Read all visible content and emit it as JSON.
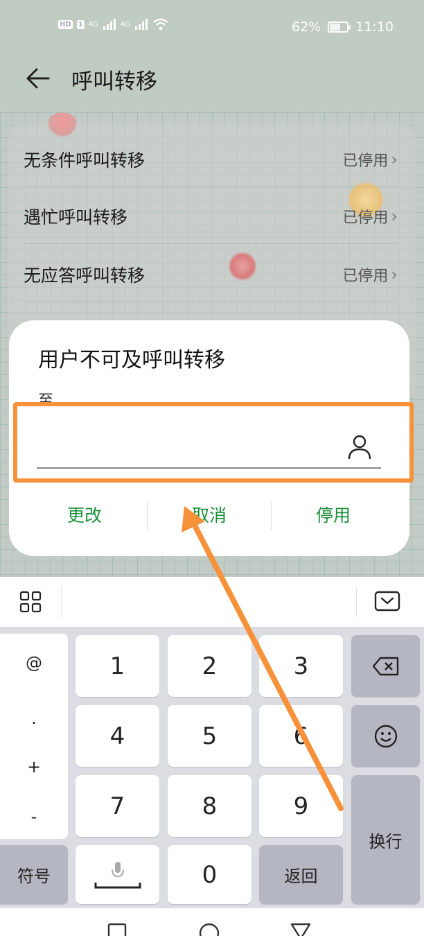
{
  "status_bar": {
    "hd_badge": "HD",
    "sim_slot": "1",
    "net_type_1": "4G",
    "net_type_2": "4G",
    "battery_percent": "62%",
    "battery_level": 0.62,
    "time": "11:10"
  },
  "header": {
    "title": "呼叫转移",
    "back_icon": "back-arrow-icon"
  },
  "settings_rows": [
    {
      "label": "无条件呼叫转移",
      "status": "已停用"
    },
    {
      "label": "遇忙呼叫转移",
      "status": "已停用"
    },
    {
      "label": "无应答呼叫转移",
      "status": "已停用"
    }
  ],
  "dialog": {
    "title": "用户不可及呼叫转移",
    "to_label": "至",
    "input_value": "",
    "contact_icon": "person-icon",
    "buttons": {
      "change": "更改",
      "cancel": "取消",
      "disable": "停用"
    },
    "accent_color": "#1a8f3a"
  },
  "annotation": {
    "highlight_color": "#f7913a"
  },
  "keyboard": {
    "toolbar_left_icon": "grid-icon",
    "toolbar_right_icon": "keyboard-hide-icon",
    "symbols": [
      "@",
      ".",
      "+",
      "-"
    ],
    "digits": [
      "1",
      "2",
      "3",
      "4",
      "5",
      "6",
      "7",
      "8",
      "9",
      "0"
    ],
    "symbol_key": "符号",
    "return_key": "返回",
    "enter_key": "换行",
    "backspace_icon": "backspace-icon",
    "emoji_icon": "emoji-icon",
    "mic_icon": "microphone-icon"
  },
  "navbar": {
    "icons": [
      "square-icon",
      "circle-icon",
      "triangle-icon"
    ]
  }
}
